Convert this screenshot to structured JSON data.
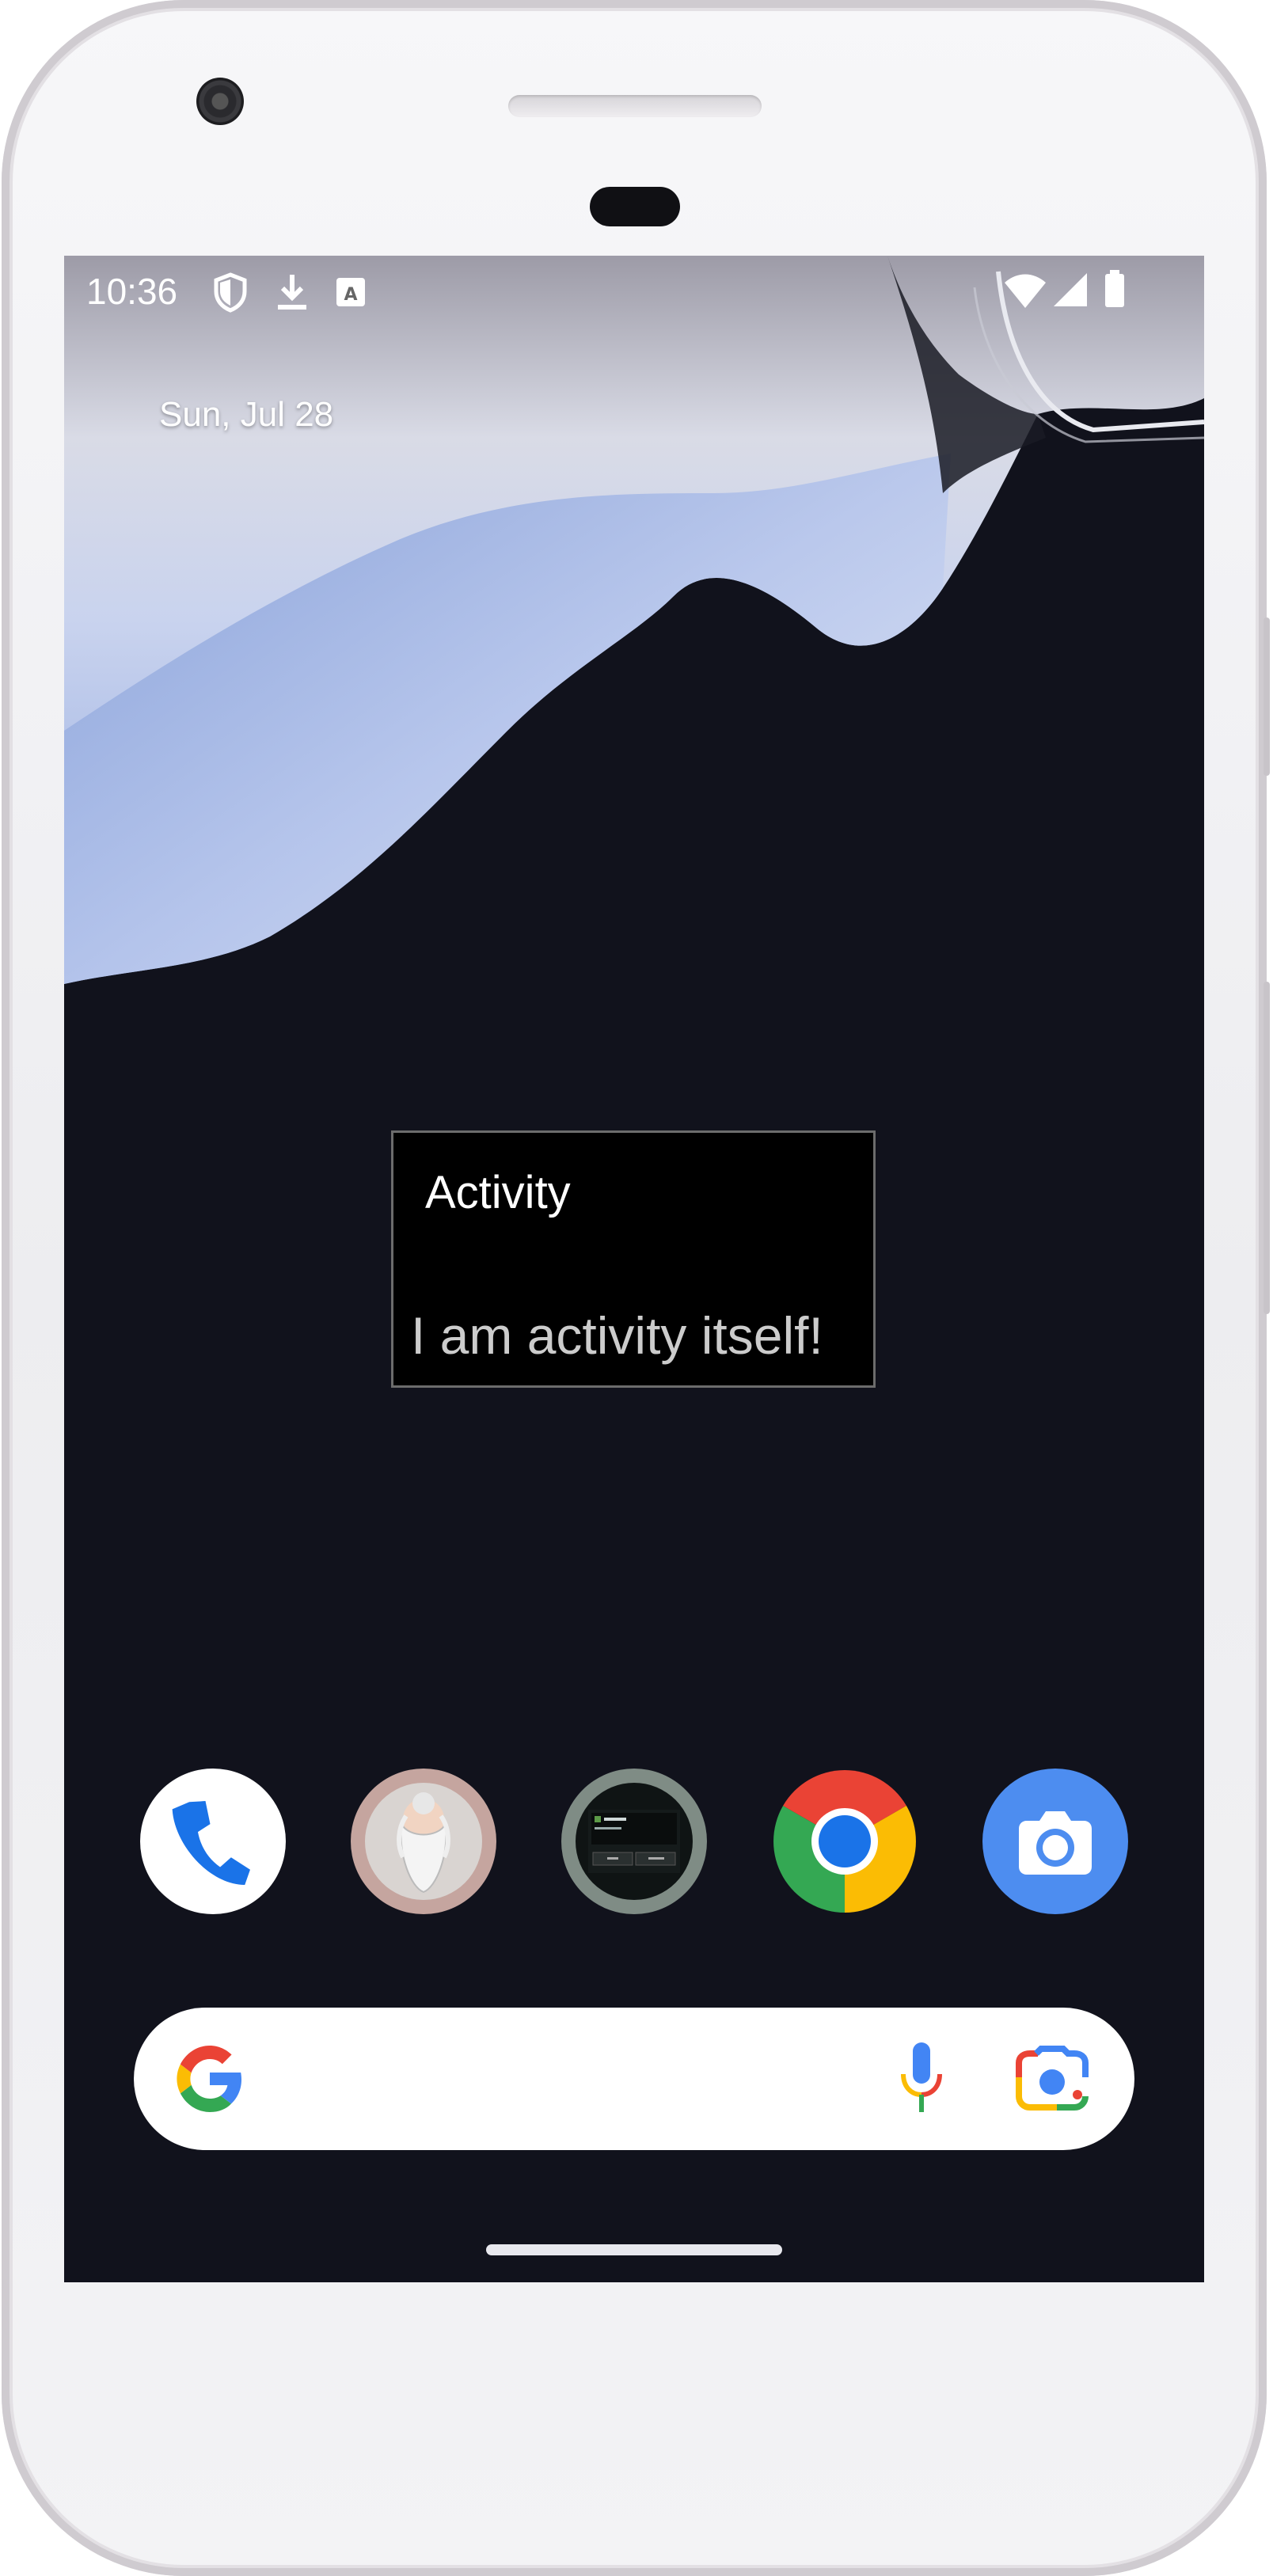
{
  "status_bar": {
    "time": "10:36",
    "icons": [
      "shield-icon",
      "download-icon",
      "keyboard-a-icon",
      "wifi-icon",
      "cell-signal-icon",
      "battery-icon"
    ]
  },
  "home": {
    "date": "Sun, Jul 28"
  },
  "dialog": {
    "title": "Activity",
    "message": "I am activity itself!"
  },
  "dock": {
    "apps": [
      "phone-app-icon",
      "sage-avatar-app-icon",
      "dialog-app-icon",
      "chrome-app-icon",
      "camera-app-icon"
    ]
  },
  "search_bar": {
    "icons": [
      "google-g-icon",
      "microphone-icon",
      "google-lens-icon"
    ]
  },
  "colors": {
    "wallpaper_dark": "#11121c",
    "wallpaper_blue": "#8aa4dd",
    "dialog_bg": "#000000",
    "dialog_border": "#6c6c6c",
    "phone_blue": "#1a73e8",
    "chrome_red": "#ea4335",
    "chrome_yellow": "#fbbc04",
    "chrome_green": "#34a853",
    "camera_blue": "#4d8df0"
  }
}
